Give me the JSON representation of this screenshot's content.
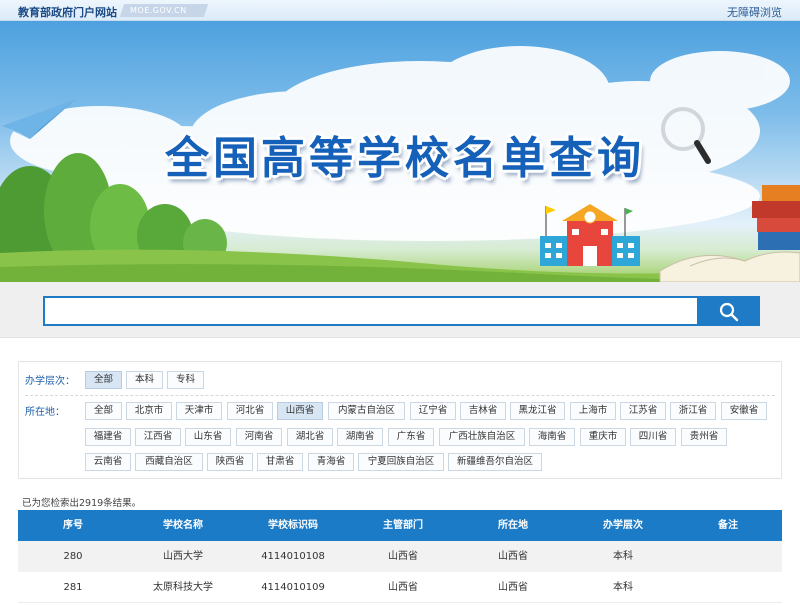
{
  "topbar": {
    "site_name": "教育部政府门户网站",
    "domain": "MOE.GOV.CN",
    "accessibility": "无障碍浏览"
  },
  "banner": {
    "title": "全国高等学校名单查询"
  },
  "search": {
    "value": "",
    "placeholder": "",
    "button_icon": "search-icon"
  },
  "filters": {
    "level_label": "办学层次：",
    "levels": [
      "全部",
      "本科",
      "专科"
    ],
    "level_selected": "全部",
    "location_label": "所在地：",
    "locations": [
      "全部",
      "北京市",
      "天津市",
      "河北省",
      "山西省",
      "内蒙古自治区",
      "辽宁省",
      "吉林省",
      "黑龙江省",
      "上海市",
      "江苏省",
      "浙江省",
      "安徽省",
      "福建省",
      "江西省",
      "山东省",
      "河南省",
      "湖北省",
      "湖南省",
      "广东省",
      "广西壮族自治区",
      "海南省",
      "重庆市",
      "四川省",
      "贵州省",
      "云南省",
      "西藏自治区",
      "陕西省",
      "甘肃省",
      "青海省",
      "宁夏回族自治区",
      "新疆维吾尔自治区"
    ],
    "location_selected": "山西省"
  },
  "results": {
    "count_text": "已为您检索出2919条结果。",
    "columns": [
      "序号",
      "学校名称",
      "学校标识码",
      "主管部门",
      "所在地",
      "办学层次",
      "备注"
    ],
    "rows": [
      [
        "280",
        "山西大学",
        "4114010108",
        "山西省",
        "山西省",
        "本科",
        ""
      ],
      [
        "281",
        "太原科技大学",
        "4114010109",
        "山西省",
        "山西省",
        "本科",
        ""
      ]
    ]
  },
  "colors": {
    "primary": "#1b7bc7",
    "title": "#1560b8",
    "link": "#1f5fa8"
  }
}
